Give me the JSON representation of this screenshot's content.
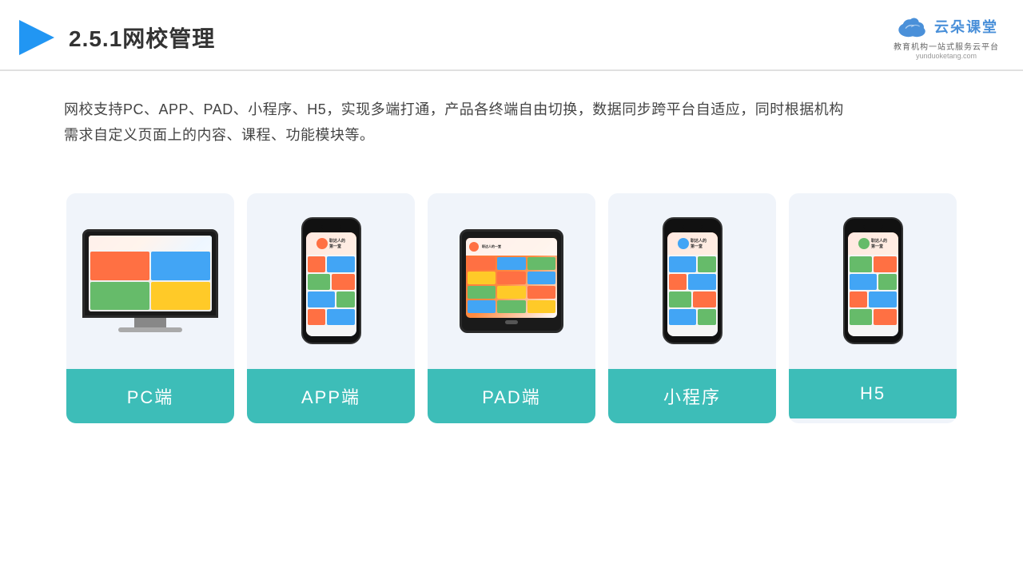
{
  "header": {
    "title": "2.5.1网校管理",
    "logo": {
      "main_text": "云朵课堂",
      "subtitle": "教育机构一站\n式服务云平台",
      "url": "yunduoketang.com"
    }
  },
  "description": {
    "text": "网校支持PC、APP、PAD、小程序、H5，实现多端打通，产品各终端自由切换，数据同步跨平台自适应，同时根据机构需求自定义页面上的内容、课程、功能模块等。"
  },
  "cards": [
    {
      "id": "pc",
      "label": "PC端"
    },
    {
      "id": "app",
      "label": "APP端"
    },
    {
      "id": "pad",
      "label": "PAD端"
    },
    {
      "id": "miniprogram",
      "label": "小程序"
    },
    {
      "id": "h5",
      "label": "H5"
    }
  ],
  "colors": {
    "teal": "#3dbdb8",
    "accent_blue": "#4a90d9",
    "card_bg": "#f0f4fa"
  }
}
